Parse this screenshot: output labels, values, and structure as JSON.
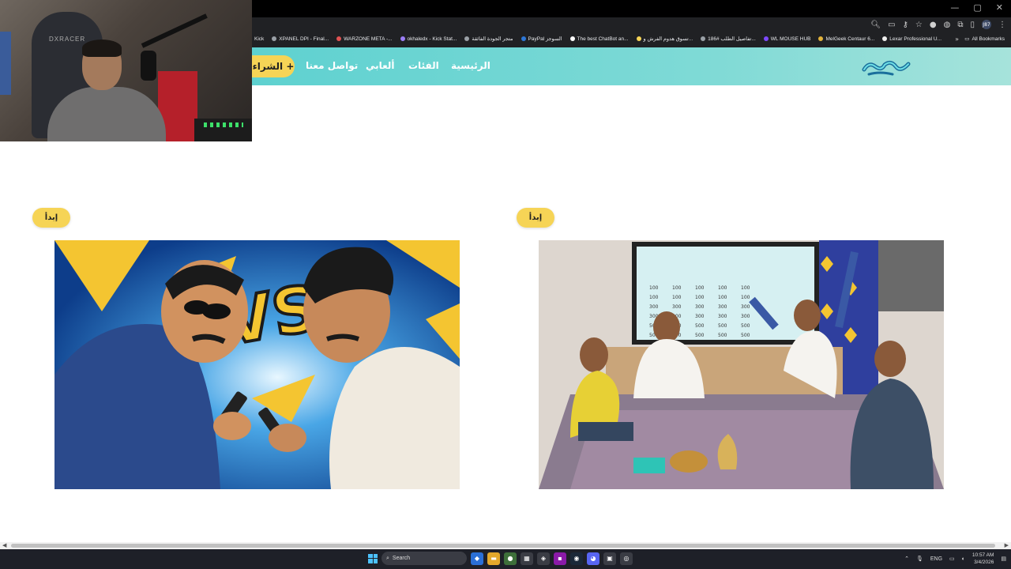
{
  "browser": {
    "bookmarks": [
      {
        "label": "Kick"
      },
      {
        "label": "XPANEL DPI - Final..."
      },
      {
        "label": "WARZONE META -..."
      },
      {
        "label": "okhaledx - Kick Stat..."
      },
      {
        "label": "متجر الجودة الفائقة"
      },
      {
        "label": "PayPal السوجز"
      },
      {
        "label": "The best ChatBot an..."
      },
      {
        "label": "تسوق هدوم الفرش و..."
      },
      {
        "label": "تفاصيل الطلب #186..."
      },
      {
        "label": "WL MOUSE HUB"
      },
      {
        "label": "MelGeek Centaur 6..."
      },
      {
        "label": "Lexar Professional U..."
      }
    ],
    "all_bookmarks_label": "All Bookmarks",
    "more_symbol": "»",
    "profile_initials": "J87"
  },
  "webcam": {
    "chair_brand": "DXRACER"
  },
  "nav": {
    "buy_label": "الشراء +",
    "contact_label": "تواصل معنا",
    "my_games_label": "ألعابي",
    "categories_label": "الفئات",
    "home_label": "الرئيسية"
  },
  "cards": {
    "left": {
      "start_label": "إبدأ"
    },
    "right": {
      "start_label": "إبدأ"
    }
  },
  "illustration_board": {
    "values": [
      "100",
      "100",
      "100",
      "100",
      "100",
      "100",
      "100",
      "100",
      "100",
      "100",
      "300",
      "300",
      "300",
      "300",
      "300",
      "300",
      "300",
      "300",
      "300",
      "300",
      "500",
      "500",
      "500",
      "500",
      "500",
      "500",
      "500",
      "500",
      "500",
      "500"
    ]
  },
  "taskbar": {
    "search_placeholder": "Search",
    "lang": "ENG",
    "time": "10:57 AM",
    "date": "3/4/2026"
  },
  "colors": {
    "nav_gradient_start": "#5ed1d0",
    "accent_yellow": "#f6d456"
  }
}
